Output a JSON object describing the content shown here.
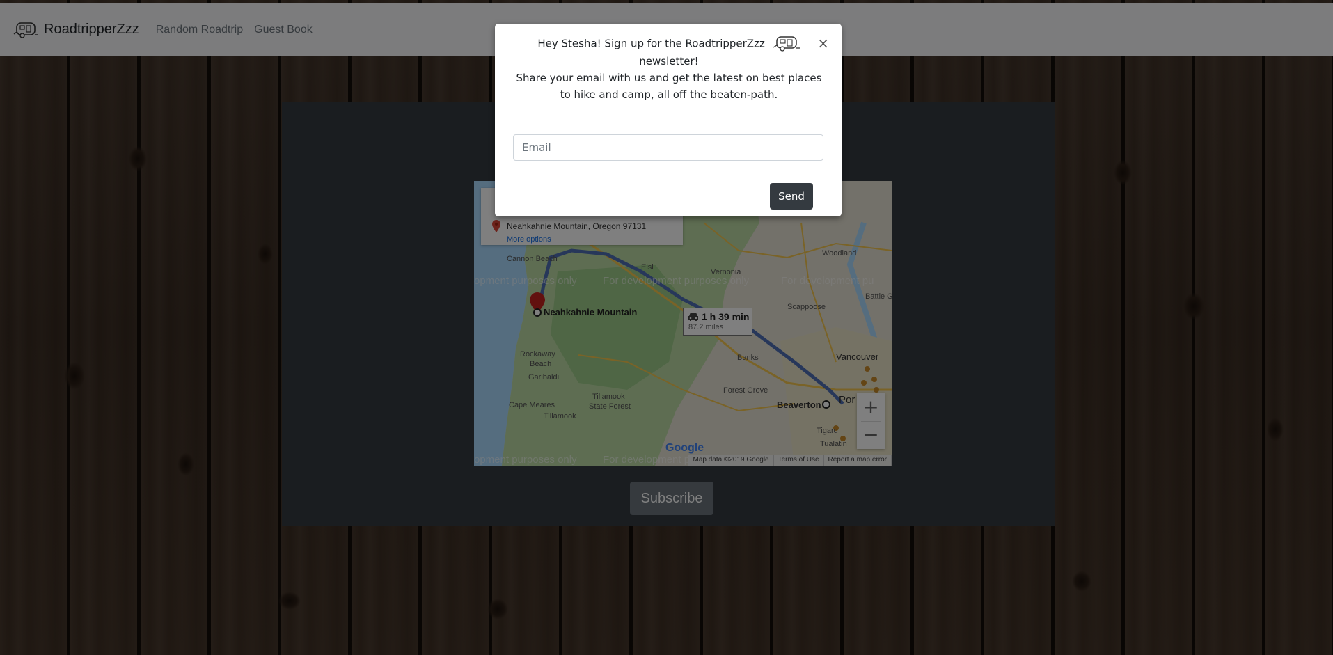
{
  "navbar": {
    "brand": "RoadtripperZzz",
    "brand_icon": "camper-trailer-icon",
    "links": [
      "Random Roadtrip",
      "Guest Book"
    ]
  },
  "modal": {
    "line1": "Hey Stesha! Sign up for the RoadtripperZzz",
    "line2": "newsletter!",
    "line3": "Share your email with us and get the latest on best places",
    "line4": "to hike and camp, all off the beaten-path.",
    "close_label": "×",
    "email_placeholder": "Email",
    "send_label": "Send"
  },
  "map": {
    "place_address": "Neahkahnie Mountain, Oregon 97131",
    "more_options": "More options",
    "destination_label": "Neahkahnie Mountain",
    "route_time": "1 h 39 min",
    "route_distance": "87.2 miles",
    "watermark": "For development purposes only",
    "watermark_left": "opment purposes only",
    "watermark_right": "For development p",
    "watermark_right_top": "For development pu",
    "labels": {
      "cannon_beach": "Cannon Beach",
      "vernonia": "Vernonia",
      "woodland": "Woodland",
      "scappoose": "Scappoose",
      "battle_g": "Battle G",
      "vancouver": "Vancouver",
      "rockaway": "Rockaway",
      "beach": "Beach",
      "garibaldi": "Garibaldi",
      "banks": "Banks",
      "tillamook_state": "Tillamook",
      "state_forest": "State Forest",
      "forest_grove": "Forest Grove",
      "beaverton": "Beaverton",
      "portland": "Por",
      "cape_meares": "Cape Meares",
      "tillamook": "Tillamook",
      "tigard": "Tigard",
      "tualatin": "Tualatin",
      "elsie": "Elsi"
    },
    "google": "Google",
    "attribution": [
      "Map data ©2019 Google",
      "Terms of Use",
      "Report a map error"
    ],
    "zoom_in": "+",
    "zoom_out": "−"
  },
  "subscribe_label": "Subscribe",
  "colors": {
    "navbar_bg": "#f8f9fa",
    "panel_bg": "#343a40",
    "send_bg": "#343a40",
    "subscribe_bg": "#6c757d"
  }
}
